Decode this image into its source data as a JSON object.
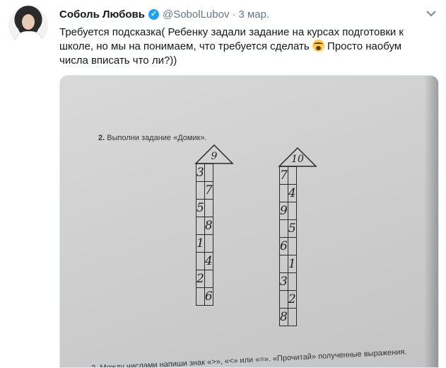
{
  "tweet": {
    "author_name": "Соболь Любовь",
    "verified_mark": "✓",
    "handle": "@SobolLubov",
    "separator": "·",
    "date": "3 мар.",
    "menu_icon": "chevron-down-icon",
    "text_part1": "Требуется подсказка( Ребенку задали задание на курсах подготовки к школе, но мы на понимаем, что требуется сделать ",
    "emoji": "scream-emoji",
    "text_part2": " Просто наобум числа вписать что ли?))"
  },
  "photo": {
    "task2_number": "2.",
    "task2_text": "Выполни задание «Домик».",
    "task3_text": "3. Между числами напиши знак «>», «<» или «=». «Прочитай» полученные выражения.",
    "houses": [
      {
        "roof": "9",
        "rows": [
          [
            "3",
            ""
          ],
          [
            "",
            "7"
          ],
          [
            "5",
            ""
          ],
          [
            "",
            "8"
          ],
          [
            "1",
            ""
          ],
          [
            "",
            "4"
          ],
          [
            "2",
            ""
          ],
          [
            "",
            "6"
          ]
        ]
      },
      {
        "roof": "10",
        "rows": [
          [
            "7",
            ""
          ],
          [
            "",
            "4"
          ],
          [
            "9",
            ""
          ],
          [
            "",
            "5"
          ],
          [
            "6",
            ""
          ],
          [
            "",
            "1"
          ],
          [
            "3",
            ""
          ],
          [
            "",
            "2"
          ],
          [
            "8",
            ""
          ]
        ]
      }
    ]
  }
}
